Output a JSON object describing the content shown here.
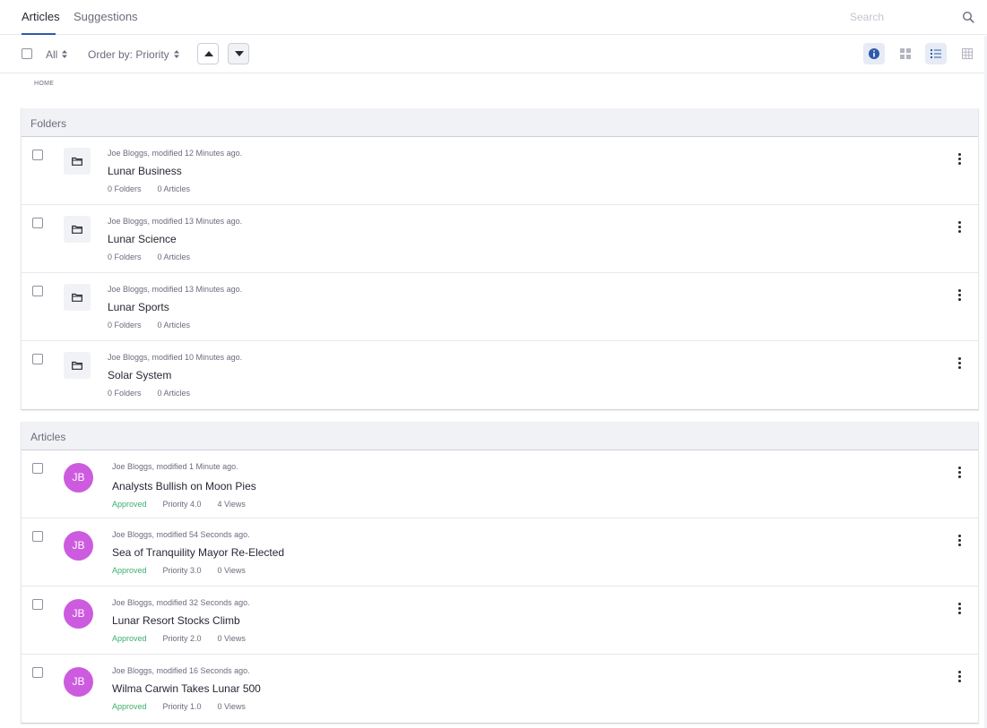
{
  "tabs": [
    {
      "label": "Articles",
      "active": true
    },
    {
      "label": "Suggestions",
      "active": false
    }
  ],
  "search": {
    "placeholder": "Search"
  },
  "toolbar": {
    "filter_label": "All",
    "order_label": "Order by: Priority"
  },
  "breadcrumb": "HOME",
  "folders_section": {
    "title": "Folders",
    "items": [
      {
        "meta": "Joe Bloggs, modified 12 Minutes ago.",
        "title": "Lunar Business",
        "folders": "0 Folders",
        "articles": "0 Articles"
      },
      {
        "meta": "Joe Bloggs, modified 13 Minutes ago.",
        "title": "Lunar Science",
        "folders": "0 Folders",
        "articles": "0 Articles"
      },
      {
        "meta": "Joe Bloggs, modified 13 Minutes ago.",
        "title": "Lunar Sports",
        "folders": "0 Folders",
        "articles": "0 Articles"
      },
      {
        "meta": "Joe Bloggs, modified 10 Minutes ago.",
        "title": "Solar System",
        "folders": "0 Folders",
        "articles": "0 Articles"
      }
    ]
  },
  "articles_section": {
    "title": "Articles",
    "items": [
      {
        "avatar": "JB",
        "meta": "Joe Bloggs, modified 1 Minute ago.",
        "title": "Analysts Bullish on Moon Pies",
        "status": "Approved",
        "priority": "Priority 4.0",
        "views": "4 Views"
      },
      {
        "avatar": "JB",
        "meta": "Joe Bloggs, modified 54 Seconds ago.",
        "title": "Sea of Tranquility Mayor Re-Elected",
        "status": "Approved",
        "priority": "Priority 3.0",
        "views": "0 Views"
      },
      {
        "avatar": "JB",
        "meta": "Joe Bloggs, modified 32 Seconds ago.",
        "title": "Lunar Resort Stocks Climb",
        "status": "Approved",
        "priority": "Priority 2.0",
        "views": "0 Views"
      },
      {
        "avatar": "JB",
        "meta": "Joe Bloggs, modified 16 Seconds ago.",
        "title": "Wilma Carwin Takes Lunar 500",
        "status": "Approved",
        "priority": "Priority 1.0",
        "views": "0 Views"
      }
    ]
  },
  "colors": {
    "accent": "#2e5aac",
    "avatar": "#cd5bdf",
    "approved": "#3dae6f"
  },
  "icons": {
    "search": "search-icon",
    "info": "info-icon",
    "cards_view": "cards-view-icon",
    "list_view": "list-view-icon",
    "table_view": "table-view-icon",
    "folder": "folder-icon",
    "kebab": "kebab-menu-icon"
  }
}
